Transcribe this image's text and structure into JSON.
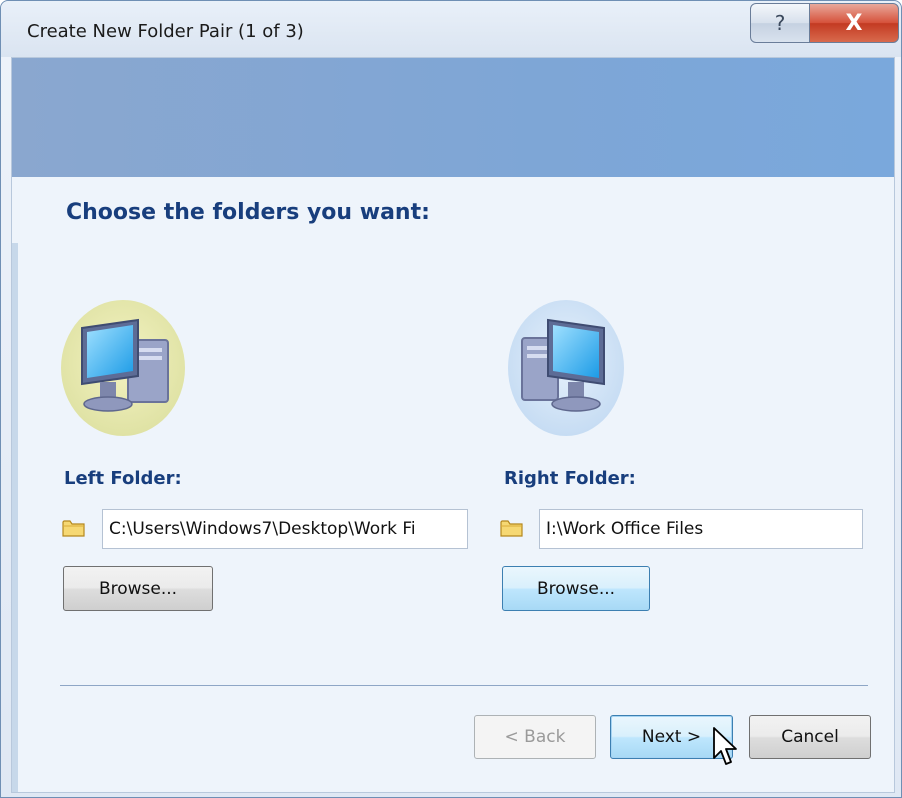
{
  "window": {
    "title": "Create New Folder Pair (1 of 3)",
    "help_glyph": "?",
    "close_glyph": "X"
  },
  "main": {
    "heading": "Choose the folders you want:",
    "left": {
      "label": "Left Folder:",
      "path": "C:\\Users\\Windows7\\Desktop\\Work Fi",
      "browse_label": "Browse..."
    },
    "right": {
      "label": "Right Folder:",
      "path": "I:\\Work Office Files",
      "browse_label": "Browse..."
    }
  },
  "footer": {
    "back_label": "< Back",
    "next_label": "Next >",
    "cancel_label": "Cancel"
  },
  "icons": {
    "computer": "computer-icon",
    "folder": "folder-icon",
    "cursor": "mouse-cursor-icon"
  },
  "colors": {
    "heading": "#183e7d",
    "banner": "#7ea6d6",
    "close_button": "#c33a22"
  }
}
